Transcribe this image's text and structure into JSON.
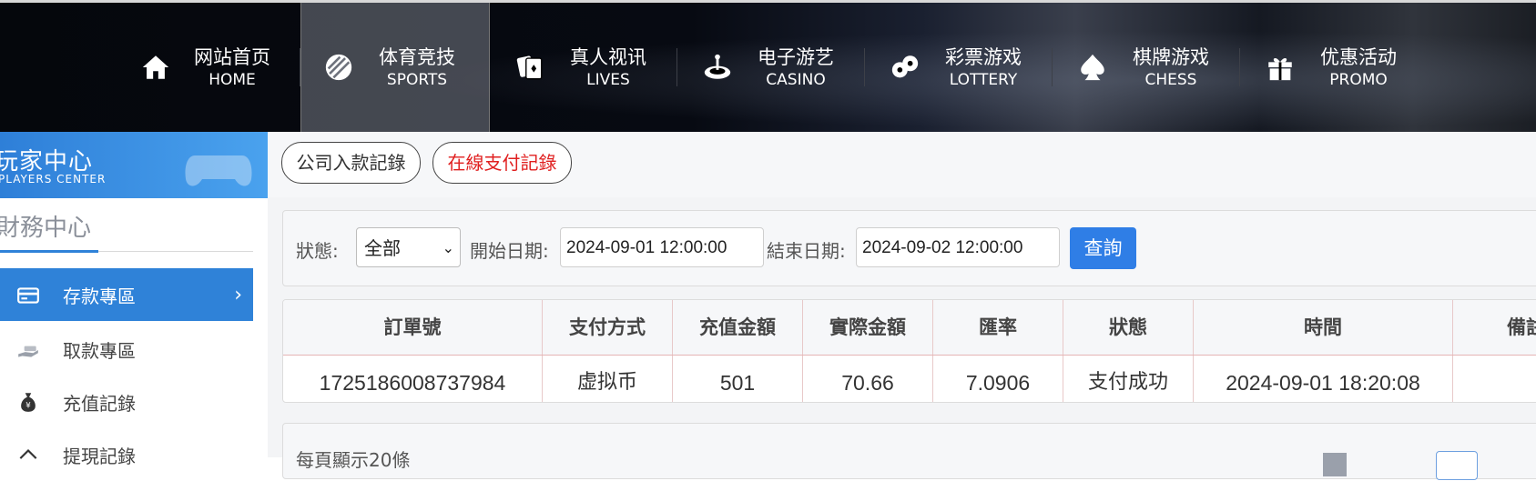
{
  "nav": {
    "items": [
      {
        "cn": "网站首页",
        "en": "HOME",
        "icon": "home-icon"
      },
      {
        "cn": "体育竞技",
        "en": "SPORTS",
        "icon": "ball-icon",
        "active": true
      },
      {
        "cn": "真人视讯",
        "en": "LIVES",
        "icon": "cards-icon"
      },
      {
        "cn": "电子游艺",
        "en": "CASINO",
        "icon": "roulette-icon"
      },
      {
        "cn": "彩票游戏",
        "en": "LOTTERY",
        "icon": "lottery-balls-icon"
      },
      {
        "cn": "棋牌游戏",
        "en": "CHESS",
        "icon": "spade-icon"
      },
      {
        "cn": "优惠活动",
        "en": "PROMO",
        "icon": "gift-icon"
      }
    ]
  },
  "sidebar": {
    "banner_title": "玩家中心",
    "banner_sub": "PLAYERS CENTER",
    "section_title": "財務中心",
    "items": [
      {
        "label": "存款專區",
        "icon": "card-icon",
        "active": true
      },
      {
        "label": "取款專區",
        "icon": "cash-hand-icon"
      },
      {
        "label": "充值記錄",
        "icon": "money-bag-icon"
      },
      {
        "label": "提現記錄",
        "icon": "withdraw-icon"
      }
    ]
  },
  "tabs": {
    "company_deposit": "公司入款記錄",
    "online_payment": "在線支付記錄"
  },
  "filter": {
    "status_label": "狀態:",
    "status_value": "全部",
    "start_label": "開始日期:",
    "start_value": "2024-09-01 12:00:00",
    "end_label": "結束日期:",
    "end_value": "2024-09-02 12:00:00",
    "query_button": "查詢"
  },
  "table": {
    "headers": [
      "訂單號",
      "支付方式",
      "充值金額",
      "實際金額",
      "匯率",
      "狀態",
      "時間",
      "備註"
    ],
    "rows": [
      [
        "1725186008737984",
        "虚拟币",
        "501",
        "70.66",
        "7.0906",
        "支付成功",
        "2024-09-01 18:20:08",
        ""
      ]
    ]
  },
  "footer": {
    "per_page": "每頁顯示20條"
  },
  "colors": {
    "accent": "#2f82d8",
    "query_button": "#2f7ee6",
    "tab_highlight": "#e02020"
  }
}
